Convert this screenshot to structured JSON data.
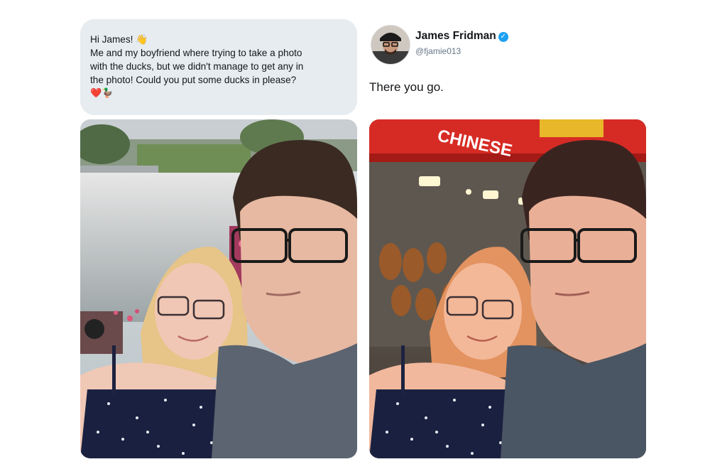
{
  "message": {
    "greeting": "Hi James! 👋",
    "lines": [
      "Me and my boyfriend where trying to take a photo",
      "with the ducks, but we didn't manage to get any in",
      "the photo! Could you put some ducks in please?"
    ],
    "emojis": "❤️🦆"
  },
  "reply": {
    "display_name": "James Fridman",
    "handle": "@fjamie013",
    "text": "There you go."
  },
  "edited_photo": {
    "sign_text": "CHINESE"
  },
  "colors": {
    "bubble": "#e6ecf0",
    "verified": "#1da1f2",
    "sign": "#d62b24"
  }
}
